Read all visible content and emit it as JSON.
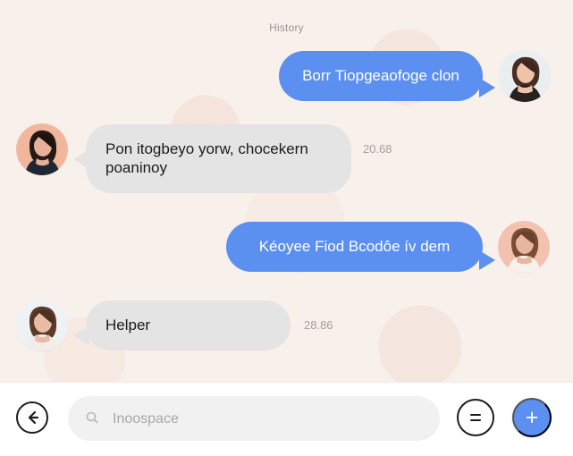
{
  "header": {
    "title": "History"
  },
  "messages": [
    {
      "direction": "outgoing",
      "text": "Borr Tiopgeaofoge clon",
      "avatar_icon": "woman-dark-hair-avatar"
    },
    {
      "direction": "incoming",
      "text": "Pon itogbeyo yorw, chocekern poaninoy",
      "time": "20.68",
      "avatar_icon": "woman-dark-hair-avatar"
    },
    {
      "direction": "outgoing",
      "text": "Kéoyee Fiod Bcodôe ív dem",
      "avatar_icon": "woman-light-top-avatar"
    },
    {
      "direction": "incoming",
      "text": "Helper",
      "time": "28.86",
      "avatar_icon": "woman-brown-hair-avatar"
    }
  ],
  "composer": {
    "back_icon": "back-arrow-icon",
    "search_icon": "search-icon",
    "placeholder": "Inoospace",
    "menu_icon": "equal-menu-icon",
    "add_icon": "plus-icon",
    "add_label": "+"
  },
  "colors": {
    "background": "#f8f0eb",
    "outgoing_bubble": "#5b8ff0",
    "incoming_bubble": "#e5e4e4",
    "accent": "#5b8ff0"
  }
}
